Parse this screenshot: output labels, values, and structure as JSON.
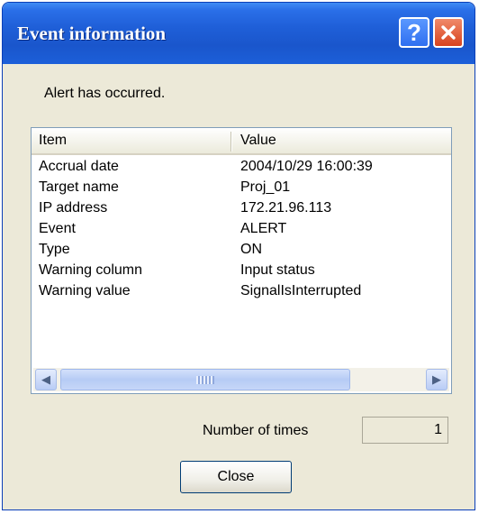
{
  "window": {
    "title": "Event information"
  },
  "message": "Alert has occurred.",
  "list": {
    "columns": [
      "Item",
      "Value"
    ],
    "rows": [
      {
        "item": "Accrual date",
        "value": "2004/10/29 16:00:39"
      },
      {
        "item": "Target name",
        "value": "Proj_01"
      },
      {
        "item": "IP address",
        "value": "172.21.96.113"
      },
      {
        "item": "Event",
        "value": "ALERT"
      },
      {
        "item": "Type",
        "value": "ON"
      },
      {
        "item": "Warning column",
        "value": "Input status"
      },
      {
        "item": "Warning value",
        "value": "SignalIsInterrupted"
      }
    ]
  },
  "count": {
    "label": "Number of times",
    "value": "1"
  },
  "buttons": {
    "close": "Close",
    "help": "?"
  },
  "icons": {
    "help": "help-icon",
    "close": "close-icon",
    "scroll_left": "scroll-left-arrow-icon",
    "scroll_right": "scroll-right-arrow-icon"
  },
  "colors": {
    "titlebar": "#1f5fd8",
    "close_button": "#d8431e",
    "window_bg": "#ece9d8"
  }
}
